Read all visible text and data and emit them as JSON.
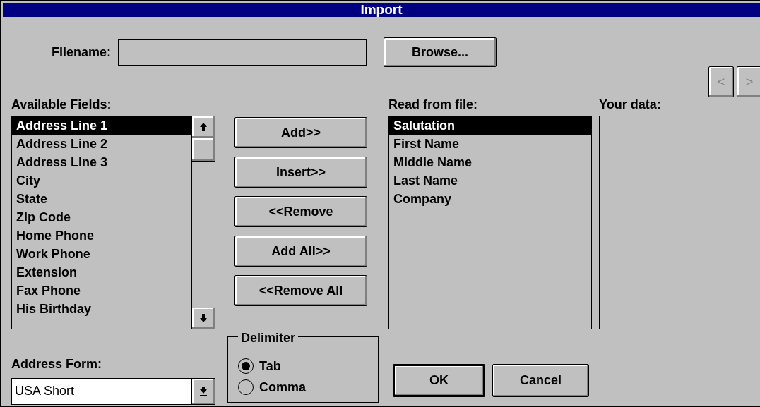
{
  "window": {
    "title": "Import"
  },
  "filename": {
    "label": "Filename:"
  },
  "browse_button": "Browse...",
  "available_fields": {
    "label": "Available Fields:",
    "items": [
      {
        "text": "Address Line 1",
        "selected": true
      },
      {
        "text": "Address Line 2",
        "selected": false
      },
      {
        "text": "Address Line 3",
        "selected": false
      },
      {
        "text": "City",
        "selected": false
      },
      {
        "text": "State",
        "selected": false
      },
      {
        "text": "Zip Code",
        "selected": false
      },
      {
        "text": "Home Phone",
        "selected": false
      },
      {
        "text": "Work Phone",
        "selected": false
      },
      {
        "text": "Extension",
        "selected": false
      },
      {
        "text": "Fax Phone",
        "selected": false
      },
      {
        "text": "His Birthday",
        "selected": false
      }
    ]
  },
  "action_buttons": [
    "Add>>",
    "Insert>>",
    "<<Remove",
    "Add All>>",
    "<<Remove All"
  ],
  "read_from_file": {
    "label": "Read from file:",
    "items": [
      {
        "text": "Salutation",
        "selected": true
      },
      {
        "text": "First Name",
        "selected": false
      },
      {
        "text": "Middle Name",
        "selected": false
      },
      {
        "text": "Last Name",
        "selected": false
      },
      {
        "text": "Company",
        "selected": false
      }
    ]
  },
  "your_data": {
    "label": "Your data:",
    "nav_buttons": [
      {
        "text": "<",
        "disabled": true
      },
      {
        "text": ">",
        "disabled": true
      }
    ]
  },
  "delimiter": {
    "label": "Delimiter",
    "options": [
      {
        "label": "Tab",
        "selected": true
      },
      {
        "label": "Comma",
        "selected": false
      }
    ]
  },
  "address_form": {
    "label": "Address Form:",
    "value": "USA Short"
  },
  "buttons": [
    {
      "label": "OK",
      "default": true
    },
    {
      "label": "Cancel",
      "default": false
    }
  ]
}
